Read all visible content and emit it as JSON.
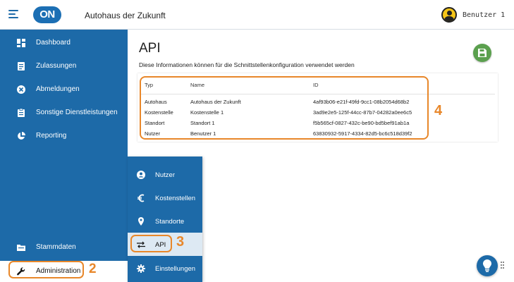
{
  "header": {
    "logo_text": "ON",
    "title": "Autohaus der Zukunft",
    "user": "Benutzer 1"
  },
  "sidebar": {
    "items": [
      {
        "label": "Dashboard",
        "icon": "dashboard-icon"
      },
      {
        "label": "Zulassungen",
        "icon": "document-icon"
      },
      {
        "label": "Abmeldungen",
        "icon": "cancel-circle-icon"
      },
      {
        "label": "Sonstige Dienstleistungen",
        "icon": "clipboard-icon"
      },
      {
        "label": "Reporting",
        "icon": "pie-chart-icon"
      },
      {
        "label": "Stammdaten",
        "icon": "folder-icon"
      },
      {
        "label": "Administration",
        "icon": "wrench-icon"
      }
    ]
  },
  "submenu": {
    "items": [
      {
        "label": "Nutzer",
        "icon": "user-icon"
      },
      {
        "label": "Kostenstellen",
        "icon": "euro-icon"
      },
      {
        "label": "Standorte",
        "icon": "location-pin-icon"
      },
      {
        "label": "API",
        "icon": "swap-arrows-icon"
      },
      {
        "label": "Einstellungen",
        "icon": "gear-icon"
      }
    ]
  },
  "main": {
    "title": "API",
    "description": "Diese Informationen können für die Schnittstellenkonfiguration verwendet werden",
    "table": {
      "headers": [
        "Typ",
        "Name",
        "ID"
      ],
      "rows": [
        [
          "Autohaus",
          "Autohaus der Zukunft",
          "4af93b06-e21f-49fd-9cc1-08b2054d68b2"
        ],
        [
          "Kostenstelle",
          "Kostenstelle 1",
          "3ad9e2e5-125f-44cc-87b7-04282a0ee6c5"
        ],
        [
          "Standort",
          "Standort 1",
          "f5b565cf-0827-432c-be90-bd5bef91ab1a"
        ],
        [
          "Nutzer",
          "Benutzer 1",
          "63830932-5917-4334-82d5-bc6c518d39f2"
        ]
      ]
    }
  },
  "callouts": {
    "table": "4",
    "api": "3",
    "admin": "2"
  },
  "colors": {
    "primary": "#1d6aa8",
    "accent": "#e8872a",
    "save": "#5ba04e"
  }
}
